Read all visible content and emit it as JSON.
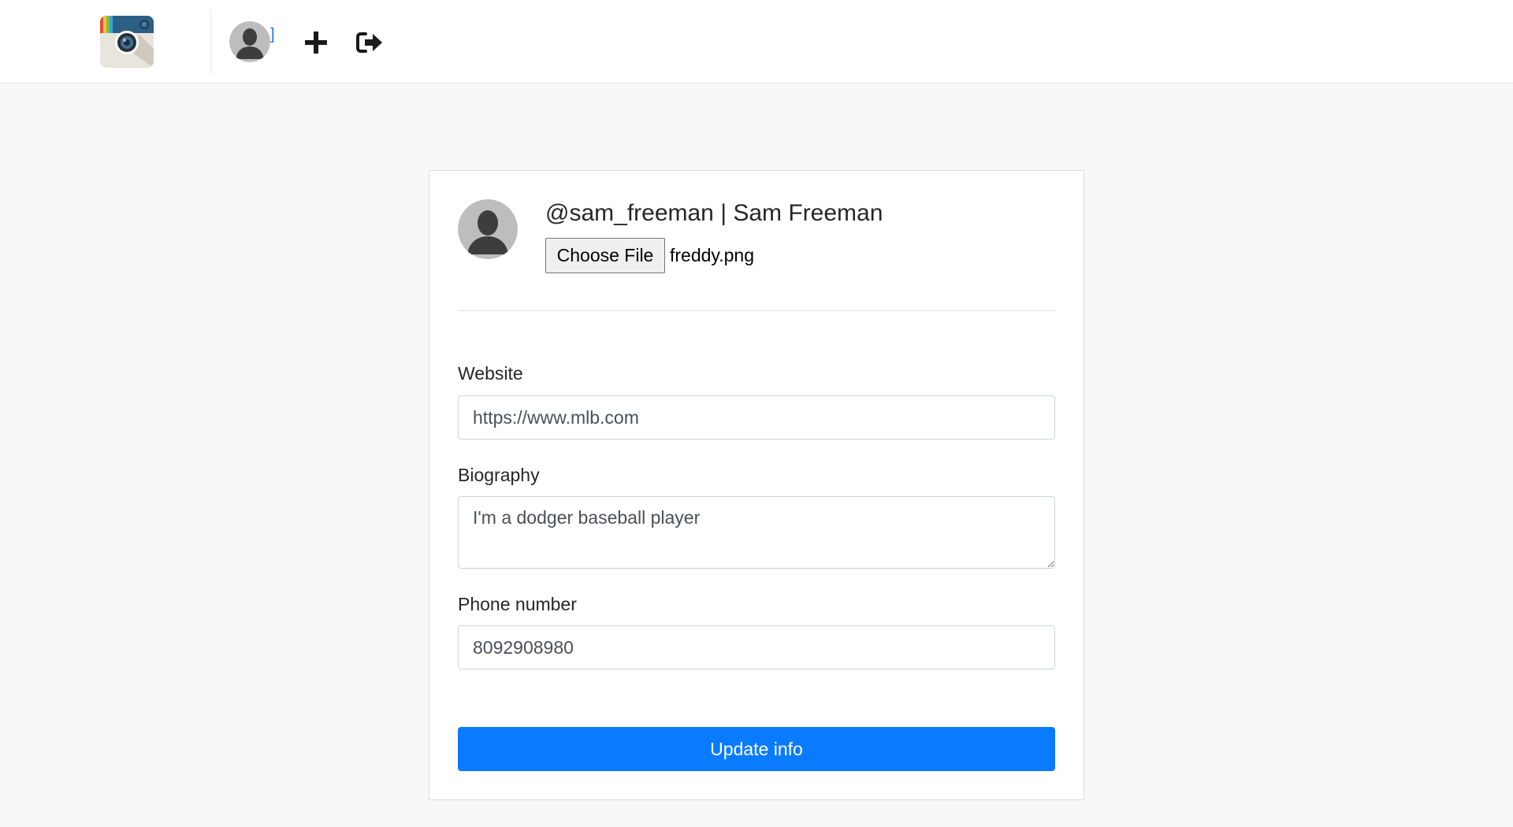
{
  "navbar": {
    "logo_icon": "instagram-camera-logo",
    "avatar_icon": "default-user-avatar",
    "bracket_text": "]",
    "add_icon": "plus-icon",
    "logout_icon": "sign-out-icon",
    "accent_color": "#1a73e8"
  },
  "profile": {
    "heading": "@sam_freeman | Sam Freeman",
    "avatar_icon": "default-user-avatar",
    "file_button_label": "Choose File",
    "file_name": "freddy.png"
  },
  "form": {
    "website": {
      "label": "Website",
      "value": "https://www.mlb.com"
    },
    "biography": {
      "label": "Biography",
      "value": "I'm a dodger baseball player"
    },
    "phone": {
      "label": "Phone number",
      "value": "8092908980"
    },
    "submit_label": "Update info",
    "submit_color": "#0a7bff"
  }
}
